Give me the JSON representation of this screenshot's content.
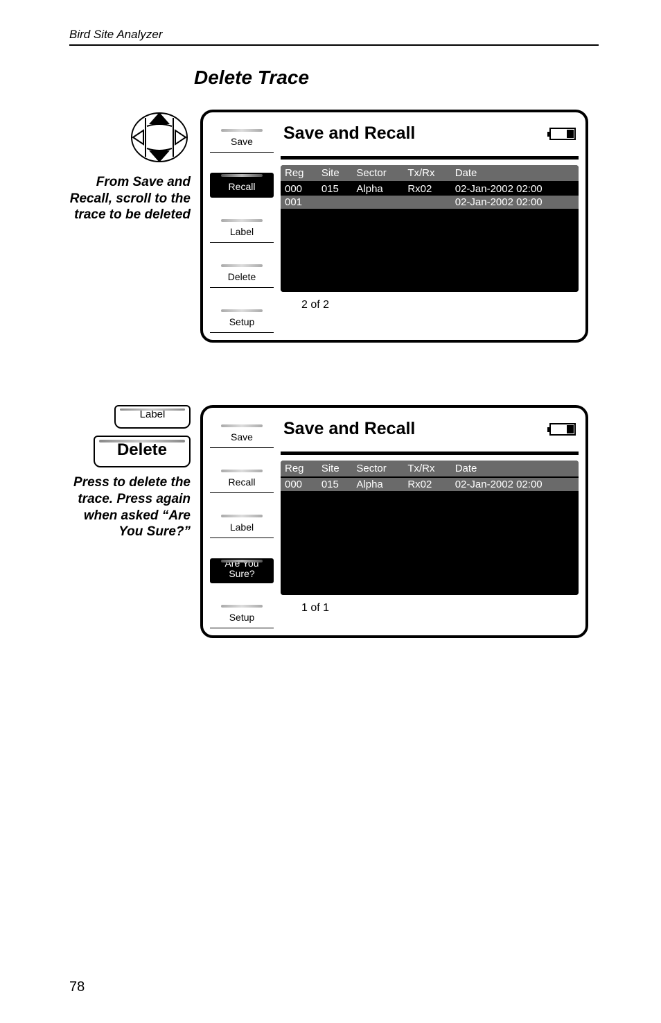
{
  "header": {
    "doc_title": "Bird Site Analyzer"
  },
  "section_title": "Delete Trace",
  "step1": {
    "caption": "From Save and Recall, scroll to the trace to be deleted",
    "side_buttons": [
      "Save",
      "Recall",
      "Label",
      "Delete",
      "Setup"
    ],
    "active_index": 1,
    "screen_title": "Save and Recall",
    "columns": [
      "Reg",
      "Site",
      "Sector",
      "Tx/Rx",
      "Date"
    ],
    "rows": [
      {
        "sel": false,
        "cells": [
          "000",
          "015",
          "Alpha",
          "Rx02",
          "02-Jan-2002 02:00"
        ]
      },
      {
        "sel": true,
        "cells": [
          "001",
          "",
          "",
          "",
          "02-Jan-2002 02:00"
        ]
      }
    ],
    "counter": "2 of 2"
  },
  "step2": {
    "softkey_above": "Label",
    "big_softkey": "Delete",
    "caption": "Press to delete the trace. Press again when asked “Are You Sure?”",
    "side_buttons": [
      "Save",
      "Recall",
      "Label",
      "Are You\nSure?",
      "Setup"
    ],
    "active_index": 3,
    "screen_title": "Save and Recall",
    "columns": [
      "Reg",
      "Site",
      "Sector",
      "Tx/Rx",
      "Date"
    ],
    "rows": [
      {
        "sel": true,
        "cells": [
          "000",
          "015",
          "Alpha",
          "Rx02",
          "02-Jan-2002 02:00"
        ]
      }
    ],
    "counter": "1 of 1"
  },
  "page_number": "78"
}
